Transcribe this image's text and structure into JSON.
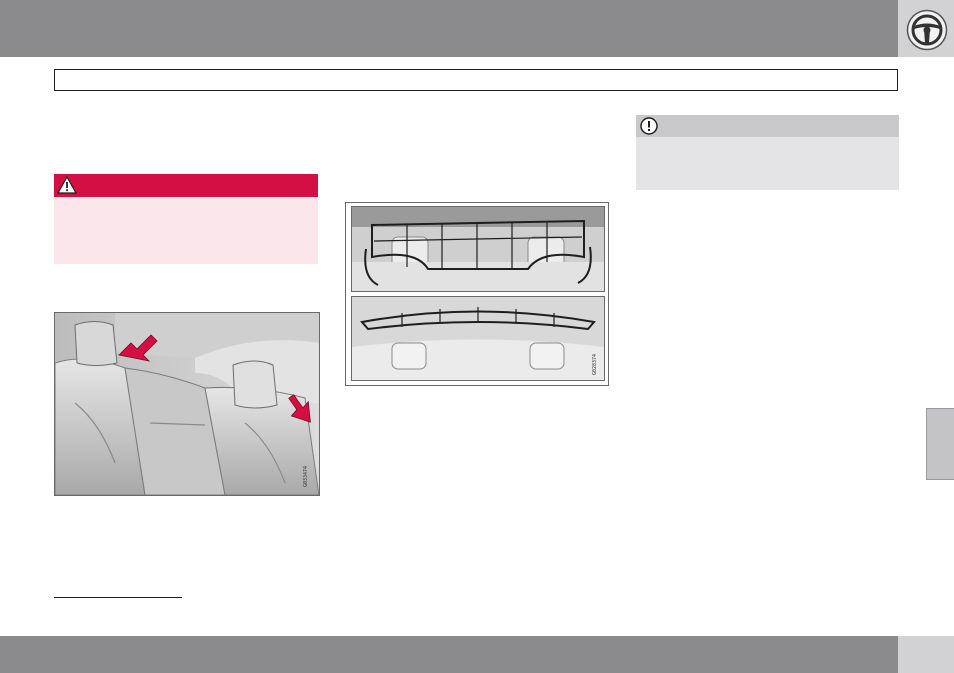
{
  "page": {
    "colors": {
      "header_bar": "#8b8b8e",
      "corner_block": "#d2d2d4",
      "warning_red": "#d40f43",
      "warning_bg": "#fbe6ec",
      "note_header": "#c9c9cc",
      "note_bg": "#e4e4e6",
      "side_tab": "#c4c4c7"
    }
  },
  "header": {
    "corner_icon": "steering-wheel-icon"
  },
  "warning": {
    "icon": "warning-triangle-icon"
  },
  "note": {
    "icon": "exclamation-circle-icon"
  },
  "figures": {
    "seats_photo": {
      "code": "G033474",
      "arrows": [
        "red-arrow-icon",
        "red-arrow-icon"
      ]
    },
    "nets_photo": {
      "code": "G028374"
    }
  }
}
